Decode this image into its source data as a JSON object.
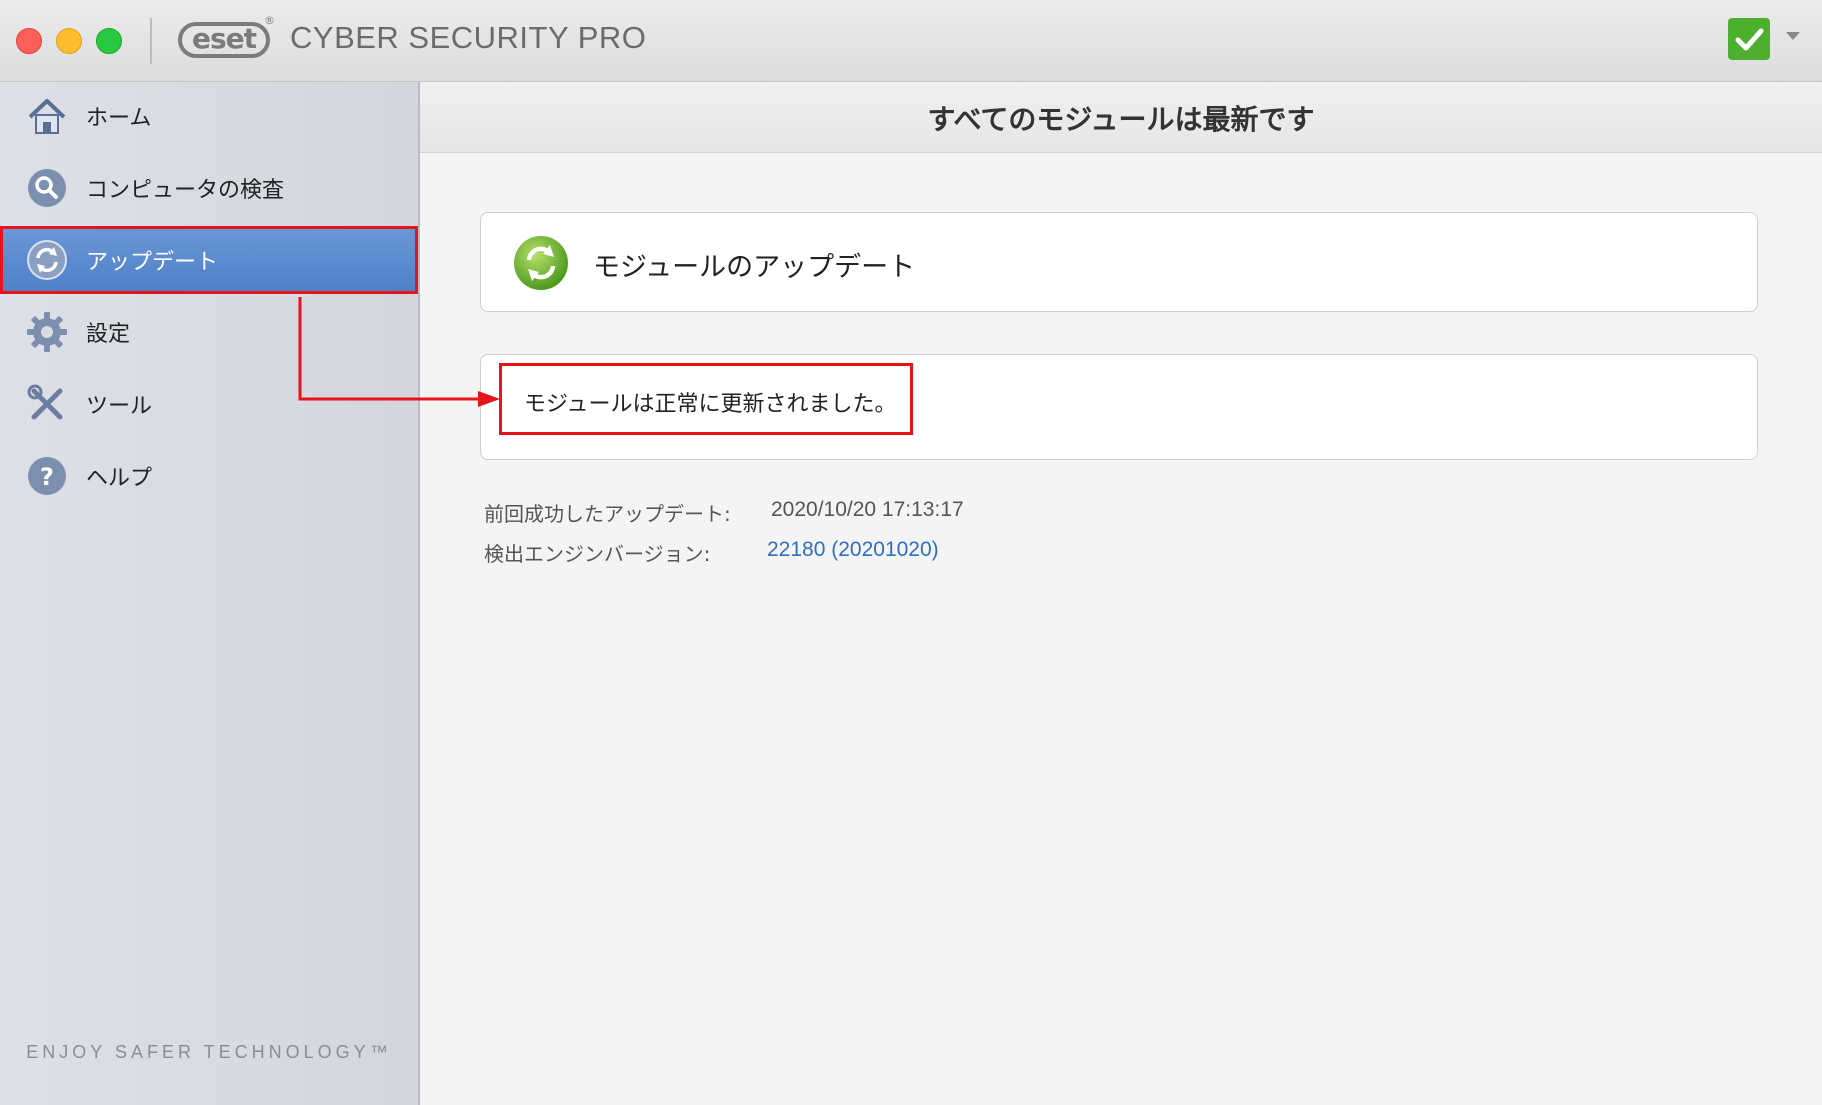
{
  "window": {
    "brand_logo": "eset",
    "app_title": "CYBER SECURITY PRO",
    "status_icon": "check-icon",
    "colors": {
      "close": "#fc5f57",
      "minimize": "#febc2e",
      "maximize": "#28c840",
      "status_ok": "#4caf2e"
    }
  },
  "sidebar": {
    "items": [
      {
        "label": "ホーム",
        "icon": "home-icon"
      },
      {
        "label": "コンピュータの検査",
        "icon": "search-icon"
      },
      {
        "label": "アップデート",
        "icon": "update-icon",
        "active": true
      },
      {
        "label": "設定",
        "icon": "gear-icon"
      },
      {
        "label": "ツール",
        "icon": "tools-icon"
      },
      {
        "label": "ヘルプ",
        "icon": "help-icon"
      }
    ],
    "tagline": "ENJOY SAFER TECHNOLOGY™",
    "active_color": "#4f7fc6"
  },
  "main": {
    "title": "すべてのモジュールは最新です",
    "update_card": {
      "label": "モジュールのアップデート",
      "icon": "update-icon"
    },
    "status_message": "モジュールは正常に更新されました。",
    "info": {
      "last_update_label": "前回成功したアップデート:",
      "last_update_value": "2020/10/20 17:13:17",
      "engine_label": "検出エンジンバージョン:",
      "engine_value": "22180 (20201020)"
    },
    "highlight_color": "#e8141c",
    "link_color": "#2f6fc0"
  }
}
